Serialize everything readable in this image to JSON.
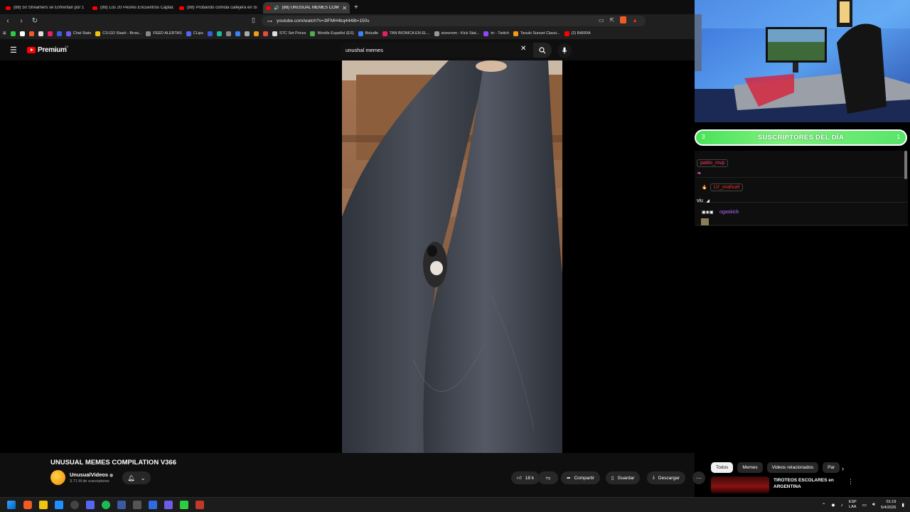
{
  "browser": {
    "tabs": [
      {
        "title": "(88) 50 Streamers se Enfrentan por 1",
        "active": false
      },
      {
        "title": "(88) Los 20 Peores Encuentros Captad",
        "active": false
      },
      {
        "title": "(88) Probando comida callejera en Si",
        "active": false
      },
      {
        "title": "(88) UNUSUAL MEMES COMP",
        "active": true
      }
    ],
    "url": "youtube.com/watch?v=3lFMH4kq4448t=150s",
    "bookmarks": [
      "Chat Stats",
      "CS:GO Stash - Brow...",
      "FEED ALERTAS",
      "CLips",
      "STC Set Prices",
      "Wordle Español (ES)",
      "Boludle",
      "TAN BIONICA EN EL...",
      "sionerom - Kick Stat...",
      "trr - Twitch",
      "Tanuki Sunset Classi...",
      "(2) BARRA"
    ]
  },
  "youtube": {
    "logo_text": "Premium",
    "country": "AR",
    "search_query": "unushal memes",
    "video": {
      "title": "UNUSUAL MEMES COMPILATION V366",
      "channel": "UnusualVideos",
      "subscribers": "3.71 M de suscriptores",
      "likes": "18 k",
      "share_label": "Compartir",
      "save_label": "Guardar",
      "download_label": "Descargar"
    },
    "chips": [
      "Todos",
      "Memes",
      "Videos relacionados",
      "Par"
    ],
    "related": {
      "title": "TIROTEOS ESCOLARES en ARGENTINA"
    }
  },
  "stream_overlay": {
    "banner": {
      "left_num": "3",
      "text": "SUSCRIPTORES DEL DÍA",
      "right_num": "1"
    },
    "chat": [
      {
        "user": "patito_mvp",
        "color": "#ff3b6b",
        "message": ""
      },
      {
        "user": "LV_snahuel",
        "color": "#ff2d2d",
        "message": "viu"
      },
      {
        "user": "ogaskick",
        "color": "#b06cff",
        "message": ""
      }
    ]
  },
  "taskbar": {
    "lang": "ESP",
    "lang_sub": "LAA",
    "time": "01:19",
    "date": "5/4/2026"
  }
}
